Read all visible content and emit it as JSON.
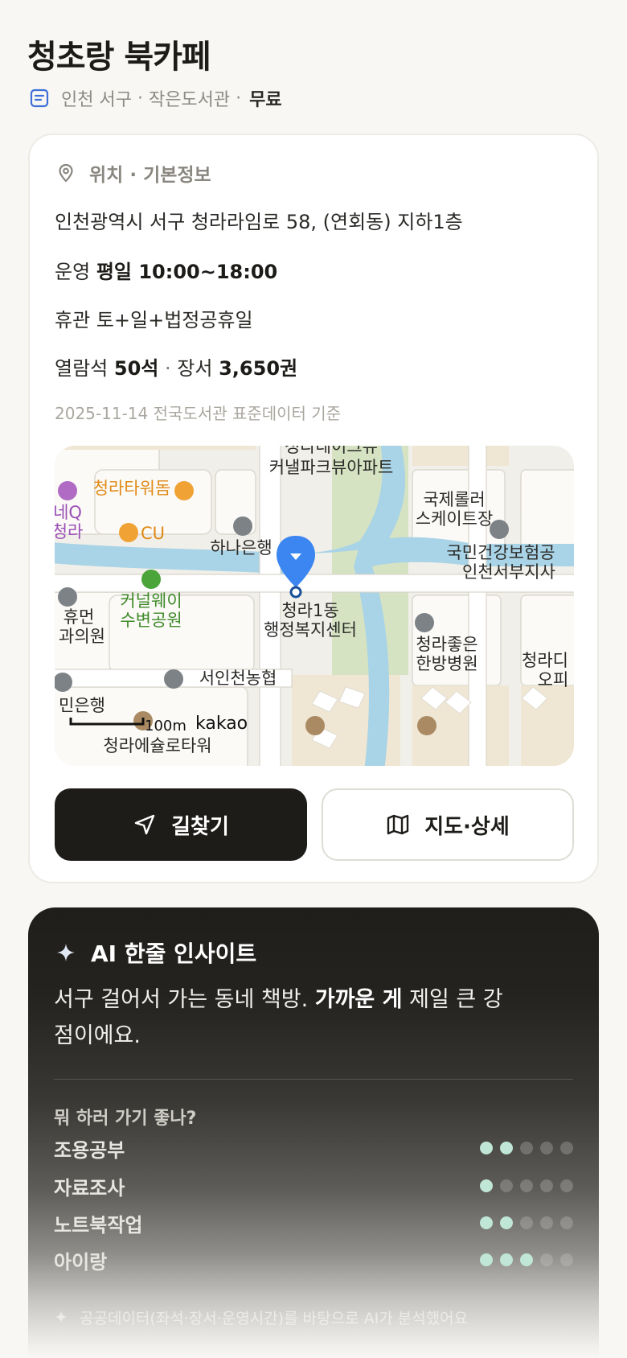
{
  "place": {
    "name": "청초랑 북카페",
    "region": "인천 서구",
    "type": "작은도서관",
    "fee": "무료"
  },
  "info": {
    "section_title": "위치 · 기본정보",
    "address": "인천광역시 서구 청라라임로 58, (연회동) 지하1층",
    "hours_label": "운영",
    "hours_value": "평일 10:00~18:00",
    "closed_label": "휴관",
    "closed_value": "토+일+법정공휴일",
    "seats_label": "열람석",
    "seats_value": "50석",
    "books_label": "장서",
    "books_value": "3,650권",
    "source": "2025-11-14 전국도서관 표준데이터 기준"
  },
  "map": {
    "labels": {
      "top_apartment_1": "청라레이크뷰",
      "top_apartment_2": "커낼파크뷰아파트",
      "tower": "청라타워돔",
      "cu": "CU",
      "hanaq_1": "네Q",
      "hanaq_2": "청라",
      "hana_bank": "하나은행",
      "rink_1": "국제롤러",
      "rink_2": "스케이트장",
      "nhis_1": "국민건강보험공",
      "nhis_2": "인천서부지사",
      "park_1": "커널웨이",
      "park_2": "수변공원",
      "center_1": "청라1동",
      "center_2": "행정복지센터",
      "clinic_1": "휴먼",
      "clinic_2": "과의원",
      "hospital_1": "청라좋은",
      "hospital_2": "한방병원",
      "office_1": "청라디",
      "office_2": "오피",
      "nh_bank": "서인천농협",
      "kb_bank": "민은행",
      "bottom_1": "청라에슐로타워",
      "scale": "100m",
      "logo": "kakao"
    },
    "colors": {
      "water": "#a9d3e6",
      "park": "#d5e3c3",
      "marker": "#3b86f0",
      "tower_text": "#e08a16",
      "park_text": "#3f8a2a"
    }
  },
  "buttons": {
    "directions": "길찾기",
    "map_detail": "지도·상세"
  },
  "ai": {
    "title": "AI 한줄 인사이트",
    "summary_1": "서구 걸어서 가는 동네 책방.",
    "summary_bold": "가까운 게",
    "summary_2": "제일 큰 강점이에요.",
    "question": "뭐 하러 가기 좋나?",
    "uses": [
      {
        "label": "조용공부",
        "score": 2,
        "max": 5
      },
      {
        "label": "자료조사",
        "score": 1,
        "max": 5
      },
      {
        "label": "노트북작업",
        "score": 2,
        "max": 5
      },
      {
        "label": "아이랑",
        "score": 3,
        "max": 5
      }
    ],
    "footnote": "공공데이터(좌석·장서·운영시간)를 바탕으로 AI가 분석했어요"
  }
}
